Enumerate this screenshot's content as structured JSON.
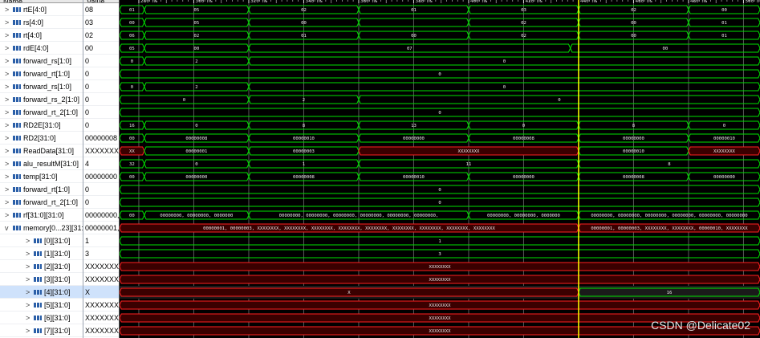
{
  "header": {
    "name_label": "Name",
    "value_label": "Value"
  },
  "timeline": {
    "ticks": [
      {
        "t": 280,
        "label": "280 ns"
      },
      {
        "t": 300,
        "label": "300 ns"
      },
      {
        "t": 320,
        "label": "320 ns"
      },
      {
        "t": 340,
        "label": "340 ns"
      },
      {
        "t": 360,
        "label": "360 ns"
      },
      {
        "t": 380,
        "label": "380 ns"
      },
      {
        "t": 400,
        "label": "400 ns"
      },
      {
        "t": 420,
        "label": "420 ns"
      },
      {
        "t": 440,
        "label": "440 ns"
      },
      {
        "t": 460,
        "label": "460 ns"
      },
      {
        "t": 480,
        "label": "480 ns"
      },
      {
        "t": 500,
        "label": "500 ns"
      }
    ],
    "t_start": 273,
    "t_end": 506,
    "cursor_time": 440
  },
  "colors": {
    "bus": "#00e000",
    "unknown": "#ff2020",
    "cursor": "#ffff00",
    "text": "#e8e8e8"
  },
  "signals": [
    {
      "name": "rtE[4:0]",
      "value": "08",
      "expand": ">",
      "indent": 0,
      "icon": "bus-icon",
      "segs": [
        {
          "s": 273,
          "e": 282,
          "v": "01"
        },
        {
          "s": 282,
          "e": 320,
          "v": "05"
        },
        {
          "s": 320,
          "e": 360,
          "v": "02"
        },
        {
          "s": 360,
          "e": 400,
          "v": "01"
        },
        {
          "s": 400,
          "e": 440,
          "v": "03"
        },
        {
          "s": 440,
          "e": 480,
          "v": "02"
        },
        {
          "s": 480,
          "e": 506,
          "v": "00"
        }
      ]
    },
    {
      "name": "rs[4:0]",
      "value": "03",
      "expand": ">",
      "indent": 0,
      "icon": "bus-icon",
      "segs": [
        {
          "s": 273,
          "e": 282,
          "v": "00"
        },
        {
          "s": 282,
          "e": 320,
          "v": "05"
        },
        {
          "s": 320,
          "e": 360,
          "v": "00"
        },
        {
          "s": 360,
          "e": 400,
          "v": ""
        },
        {
          "s": 400,
          "e": 440,
          "v": "02"
        },
        {
          "s": 440,
          "e": 480,
          "v": "00"
        },
        {
          "s": 480,
          "e": 506,
          "v": "01"
        }
      ]
    },
    {
      "name": "rt[4:0]",
      "value": "02",
      "expand": ">",
      "indent": 0,
      "icon": "bus-icon",
      "segs": [
        {
          "s": 273,
          "e": 282,
          "v": "06"
        },
        {
          "s": 282,
          "e": 320,
          "v": "02"
        },
        {
          "s": 320,
          "e": 360,
          "v": "01"
        },
        {
          "s": 360,
          "e": 400,
          "v": "00"
        },
        {
          "s": 400,
          "e": 440,
          "v": "02"
        },
        {
          "s": 440,
          "e": 480,
          "v": "00"
        },
        {
          "s": 480,
          "e": 506,
          "v": "01"
        }
      ]
    },
    {
      "name": "rdE[4:0]",
      "value": "00",
      "expand": ">",
      "indent": 0,
      "icon": "bus-icon",
      "segs": [
        {
          "s": 273,
          "e": 282,
          "v": "05"
        },
        {
          "s": 282,
          "e": 320,
          "v": "00"
        },
        {
          "s": 320,
          "e": 437,
          "v": "07"
        },
        {
          "s": 437,
          "e": 506,
          "v": "00"
        }
      ]
    },
    {
      "name": "forward_rs[1:0]",
      "value": "0",
      "expand": ">",
      "indent": 0,
      "icon": "bus-icon",
      "segs": [
        {
          "s": 273,
          "e": 282,
          "v": "0"
        },
        {
          "s": 282,
          "e": 320,
          "v": "2"
        },
        {
          "s": 320,
          "e": 506,
          "v": "0"
        }
      ]
    },
    {
      "name": "forward_rt[1:0]",
      "value": "0",
      "expand": ">",
      "indent": 0,
      "icon": "bus-icon",
      "segs": [
        {
          "s": 273,
          "e": 506,
          "v": "0"
        }
      ]
    },
    {
      "name": "forward_rs[1:0]",
      "value": "0",
      "expand": ">",
      "indent": 0,
      "icon": "bus-icon",
      "segs": [
        {
          "s": 273,
          "e": 282,
          "v": "0"
        },
        {
          "s": 282,
          "e": 320,
          "v": "2"
        },
        {
          "s": 320,
          "e": 506,
          "v": "0"
        }
      ]
    },
    {
      "name": "forward_rs_2[1:0]",
      "value": "0",
      "expand": ">",
      "indent": 0,
      "icon": "bus-icon",
      "segs": [
        {
          "s": 273,
          "e": 320,
          "v": "0"
        },
        {
          "s": 320,
          "e": 360,
          "v": "2"
        },
        {
          "s": 360,
          "e": 506,
          "v": "0"
        }
      ]
    },
    {
      "name": "forward_rt_2[1:0]",
      "value": "0",
      "expand": ">",
      "indent": 0,
      "icon": "bus-icon",
      "segs": [
        {
          "s": 273,
          "e": 506,
          "v": "0"
        }
      ]
    },
    {
      "name": "RD2E[31:0]",
      "value": "0",
      "expand": ">",
      "indent": 0,
      "icon": "bus-icon",
      "segs": [
        {
          "s": 273,
          "e": 282,
          "v": "16"
        },
        {
          "s": 282,
          "e": 320,
          "v": "0"
        },
        {
          "s": 320,
          "e": 360,
          "v": "8"
        },
        {
          "s": 360,
          "e": 400,
          "v": "13"
        },
        {
          "s": 400,
          "e": 440,
          "v": "0"
        },
        {
          "s": 440,
          "e": 480,
          "v": "8"
        },
        {
          "s": 480,
          "e": 506,
          "v": "0"
        }
      ]
    },
    {
      "name": "RD2[31:0]",
      "value": "00000008",
      "expand": ">",
      "indent": 0,
      "icon": "bus-icon",
      "segs": [
        {
          "s": 273,
          "e": 282,
          "v": "00"
        },
        {
          "s": 282,
          "e": 320,
          "v": "00000008"
        },
        {
          "s": 320,
          "e": 360,
          "v": "00000010"
        },
        {
          "s": 360,
          "e": 400,
          "v": "00000000"
        },
        {
          "s": 400,
          "e": 440,
          "v": "00000008"
        },
        {
          "s": 440,
          "e": 480,
          "v": "00000000"
        },
        {
          "s": 480,
          "e": 506,
          "v": "00000010"
        }
      ]
    },
    {
      "name": "ReadData[31:0]",
      "value": "XXXXXXXX",
      "expand": ">",
      "indent": 0,
      "icon": "bus-icon",
      "segs": [
        {
          "s": 273,
          "e": 282,
          "v": "XX",
          "x": true
        },
        {
          "s": 282,
          "e": 320,
          "v": "00000001"
        },
        {
          "s": 320,
          "e": 360,
          "v": "00000003"
        },
        {
          "s": 360,
          "e": 440,
          "v": "XXXXXXXX",
          "x": true
        },
        {
          "s": 440,
          "e": 480,
          "v": "00000010"
        },
        {
          "s": 480,
          "e": 506,
          "v": "XXXXXXXX",
          "x": true
        }
      ]
    },
    {
      "name": "alu_resultM[31:0]",
      "value": "4",
      "expand": ">",
      "indent": 0,
      "icon": "bus-icon",
      "segs": [
        {
          "s": 273,
          "e": 282,
          "v": "32"
        },
        {
          "s": 282,
          "e": 320,
          "v": "0"
        },
        {
          "s": 320,
          "e": 360,
          "v": "1"
        },
        {
          "s": 360,
          "e": 440,
          "v": "11"
        },
        {
          "s": 440,
          "e": 506,
          "v": "8"
        }
      ]
    },
    {
      "name": "temp[31:0]",
      "value": "00000000",
      "expand": ">",
      "indent": 0,
      "icon": "bus-icon",
      "segs": [
        {
          "s": 273,
          "e": 282,
          "v": "00"
        },
        {
          "s": 282,
          "e": 320,
          "v": "00000000"
        },
        {
          "s": 320,
          "e": 360,
          "v": "00000008"
        },
        {
          "s": 360,
          "e": 400,
          "v": "00000010"
        },
        {
          "s": 400,
          "e": 440,
          "v": "00000000"
        },
        {
          "s": 440,
          "e": 480,
          "v": "00000008"
        },
        {
          "s": 480,
          "e": 506,
          "v": "00000000"
        }
      ]
    },
    {
      "name": "forward_rt[1:0]",
      "value": "0",
      "expand": ">",
      "indent": 0,
      "icon": "bus-icon",
      "segs": [
        {
          "s": 273,
          "e": 506,
          "v": "0"
        }
      ]
    },
    {
      "name": "forward_rt_2[1:0]",
      "value": "0",
      "expand": ">",
      "indent": 0,
      "icon": "bus-icon",
      "segs": [
        {
          "s": 273,
          "e": 506,
          "v": "0"
        }
      ]
    },
    {
      "name": "rf[31:0][31:0]",
      "value": "00000000,",
      "expand": ">",
      "indent": 0,
      "icon": "bus-icon",
      "segs": [
        {
          "s": 273,
          "e": 282,
          "v": "00"
        },
        {
          "s": 282,
          "e": 320,
          "v": "00000000, 00000000, 0000000"
        },
        {
          "s": 320,
          "e": 400,
          "v": "00000000, 00000000, 00000000, 00000000, 00000000, 00000000,"
        },
        {
          "s": 400,
          "e": 440,
          "v": "00000000, 00000000, 0000000"
        },
        {
          "s": 440,
          "e": 506,
          "v": "00000000, 00000000, 00000000, 00000000, 00000000, 00000000"
        }
      ]
    },
    {
      "name": "memory[0...23][31:0]",
      "value": "00000001,",
      "expand": "v",
      "indent": 0,
      "icon": "bus-icon",
      "segs": [
        {
          "s": 273,
          "e": 440,
          "v": "00000001, 00000003, XXXXXXXX, XXXXXXXX, XXXXXXXX, XXXXXXXX, XXXXXXXX, XXXXXXXX, XXXXXXXX, XXXXXXXX, XXXXXXXX",
          "x": true
        },
        {
          "s": 440,
          "e": 506,
          "v": "00000001, 00000003, XXXXXXXX, XXXXXXXX, 00000010, XXXXXXXX",
          "x": true
        }
      ]
    },
    {
      "name": "[0][31:0]",
      "value": "1",
      "expand": ">",
      "indent": 1,
      "icon": "bus-icon",
      "segs": [
        {
          "s": 273,
          "e": 506,
          "v": "1"
        }
      ]
    },
    {
      "name": "[1][31:0]",
      "value": "3",
      "expand": ">",
      "indent": 1,
      "icon": "bus-icon",
      "segs": [
        {
          "s": 273,
          "e": 506,
          "v": "3"
        }
      ]
    },
    {
      "name": "[2][31:0]",
      "value": "XXXXXXXX",
      "expand": ">",
      "indent": 1,
      "icon": "bus-icon",
      "segs": [
        {
          "s": 273,
          "e": 506,
          "v": "XXXXXXXX",
          "x": true
        }
      ]
    },
    {
      "name": "[3][31:0]",
      "value": "XXXXXXXX",
      "expand": ">",
      "indent": 1,
      "icon": "bus-icon",
      "segs": [
        {
          "s": 273,
          "e": 506,
          "v": "XXXXXXXX",
          "x": true
        }
      ]
    },
    {
      "name": "[4][31:0]",
      "value": "X",
      "expand": ">",
      "indent": 1,
      "icon": "bus-icon",
      "selected": true,
      "segs": [
        {
          "s": 273,
          "e": 440,
          "v": "X",
          "x": true
        },
        {
          "s": 440,
          "e": 506,
          "v": "16"
        }
      ]
    },
    {
      "name": "[5][31:0]",
      "value": "XXXXXXXX",
      "expand": ">",
      "indent": 1,
      "icon": "bus-icon",
      "segs": [
        {
          "s": 273,
          "e": 506,
          "v": "XXXXXXXX",
          "x": true
        }
      ]
    },
    {
      "name": "[6][31:0]",
      "value": "XXXXXXXX",
      "expand": ">",
      "indent": 1,
      "icon": "bus-icon",
      "segs": [
        {
          "s": 273,
          "e": 506,
          "v": "XXXXXXXX",
          "x": true
        }
      ]
    },
    {
      "name": "[7][31:0]",
      "value": "XXXXXXXX",
      "expand": ">",
      "indent": 1,
      "icon": "bus-icon",
      "segs": [
        {
          "s": 273,
          "e": 506,
          "v": "XXXXXXXX",
          "x": true
        }
      ]
    }
  ],
  "watermark": "CSDN @Delicate02"
}
